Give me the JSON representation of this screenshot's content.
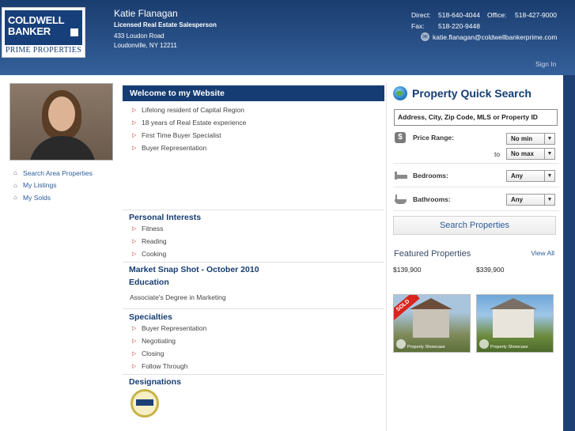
{
  "brand": {
    "line1": "COLDWELL",
    "line2": "BANKER",
    "office": "PRIME PROPERTIES"
  },
  "agent": {
    "name": "Katie Flanagan",
    "title": "Licensed Real Estate Salesperson",
    "address1": "433 Loudon Road",
    "address2": "Loudonville, NY  12211"
  },
  "contact": {
    "direct_label": "Direct:",
    "direct": "518-640-4044",
    "office_label": "Office:",
    "office": "518-427-9000",
    "fax_label": "Fax:",
    "fax": "518-220-9448",
    "email": "katie.flanagan@coldwellbankerprime.com"
  },
  "signin": "Sign In",
  "leftnav": [
    {
      "label": "Search Area Properties",
      "icon": "house-search-icon"
    },
    {
      "label": "My Listings",
      "icon": "listings-icon"
    },
    {
      "label": "My Solds",
      "icon": "sold-icon"
    }
  ],
  "welcome": {
    "title": "Welcome to my Website",
    "items": [
      "Lifelong resident of Capital Region",
      "18 years of Real Estate experience",
      "First Time Buyer Specialist",
      "Buyer Representation"
    ]
  },
  "interests": {
    "title": "Personal Interests",
    "items": [
      "Fitness",
      "Reading",
      "Cooking"
    ]
  },
  "market": {
    "title": "Market Snap Shot - October 2010"
  },
  "education": {
    "title": "Education",
    "text": "Associate's Degree in Marketing"
  },
  "specialties": {
    "title": "Specialties",
    "items": [
      "Buyer Representation",
      "Negotiating",
      "Closing",
      "Follow Through"
    ]
  },
  "designations": {
    "title": "Designations"
  },
  "quicksearch": {
    "title": "Property Quick Search",
    "placeholder": "Address, City, Zip Code, MLS or Property ID",
    "price_label": "Price Range:",
    "min": "No min",
    "to": "to",
    "max": "No max",
    "bed_label": "Bedrooms:",
    "bed": "Any",
    "bath_label": "Bathrooms:",
    "bath": "Any",
    "button": "Search Properties"
  },
  "featured": {
    "title": "Featured Properties",
    "viewall": "View All",
    "listings": [
      {
        "price": "$139,900",
        "badge": "SOLD",
        "tour": "Property Showcase"
      },
      {
        "price": "$339,900",
        "tour": "Property Showcase"
      }
    ]
  },
  "colors": {
    "header_blue": "#1d3f73",
    "accent_red": "#c0392b",
    "link_blue": "#2c5d9a"
  }
}
